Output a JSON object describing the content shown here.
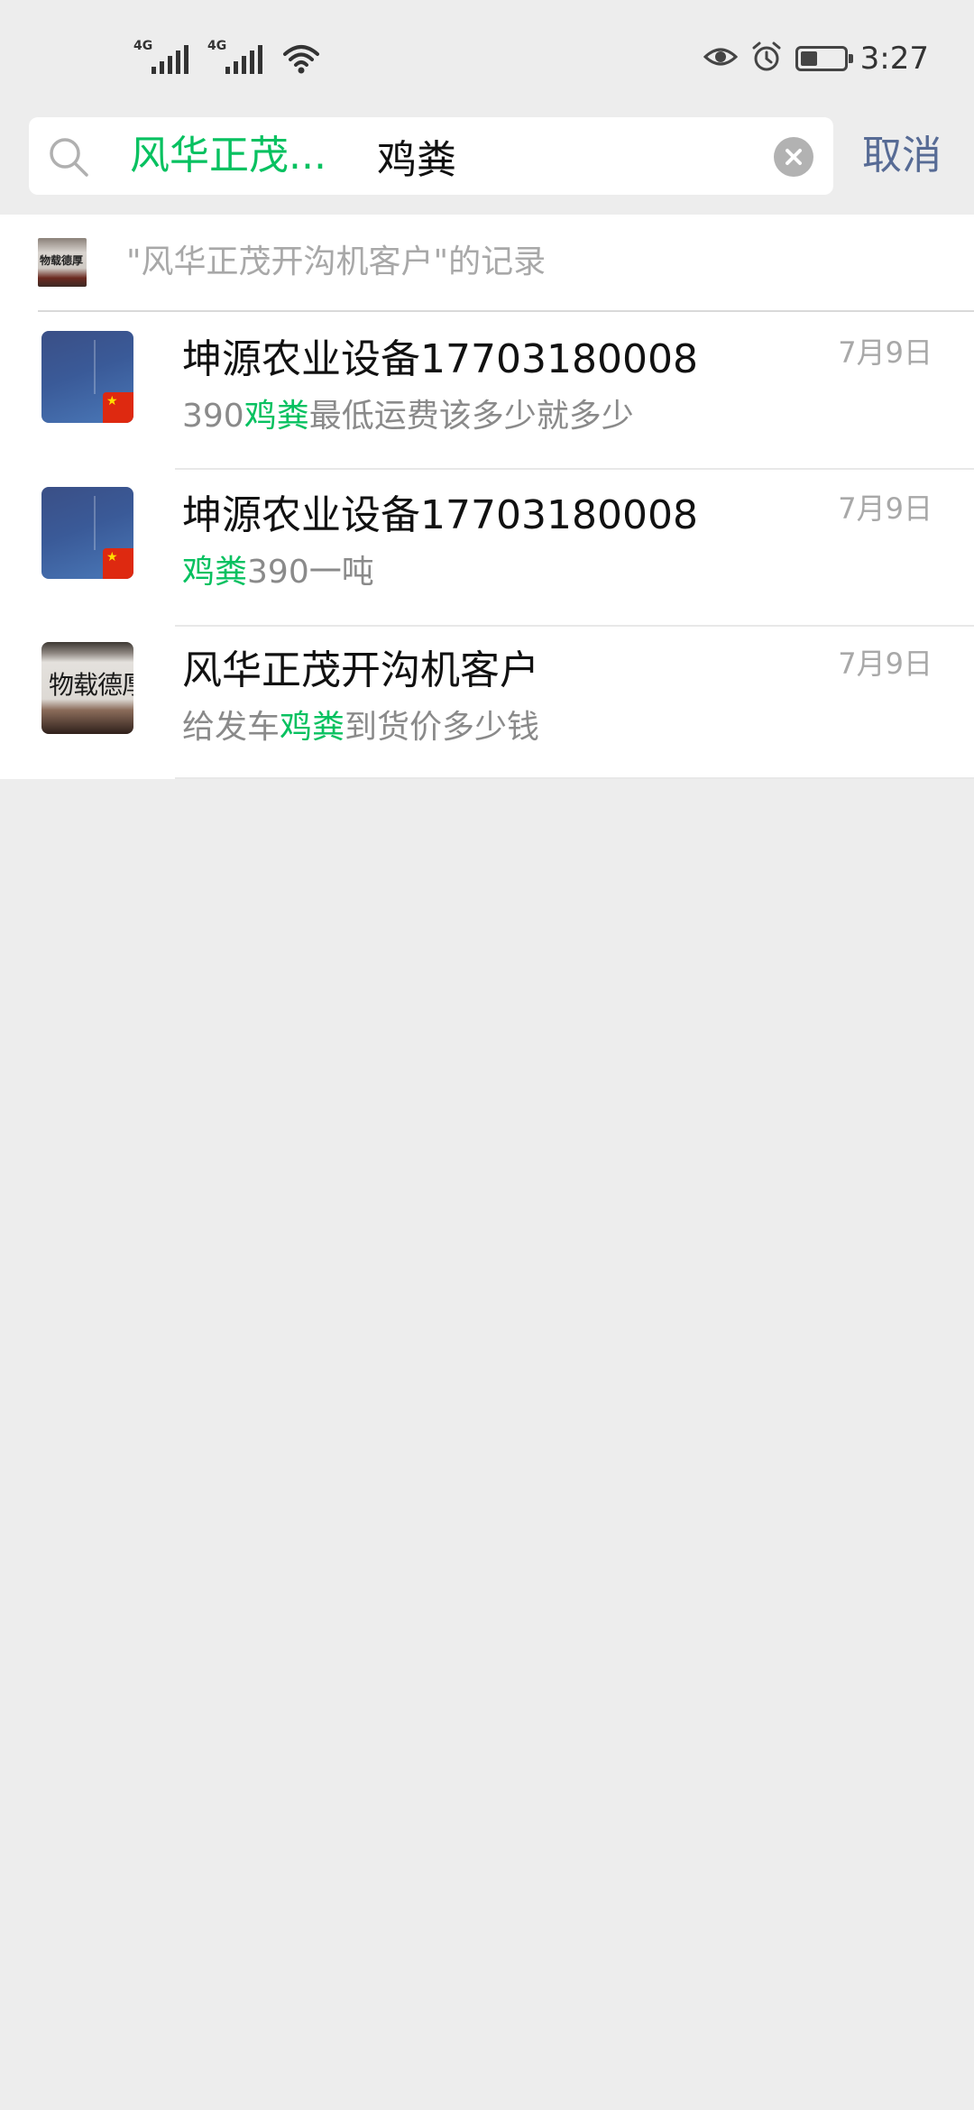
{
  "status_bar": {
    "network_1": "4G",
    "network_2": "4G",
    "time": "3:27",
    "icons": [
      "signal-icon",
      "signal-icon",
      "wifi-icon",
      "eye-icon",
      "alarm-icon",
      "battery-icon"
    ]
  },
  "search": {
    "scope_tag": "风华正茂...",
    "query": "鸡粪",
    "cancel_label": "取消"
  },
  "record_entry": {
    "label": "\"风华正茂开沟机客户\"的记录",
    "thumb_text": "物载德厚"
  },
  "results": [
    {
      "name": "坤源农业设备17703180008",
      "preview_before": "390",
      "preview_match": "鸡粪",
      "preview_after": "最低运费该多少就多少",
      "date": "7月9日"
    },
    {
      "name": "坤源农业设备17703180008",
      "preview_before": "",
      "preview_match": "鸡粪",
      "preview_after": "390一吨",
      "date": "7月9日"
    },
    {
      "name": "风华正茂开沟机客户",
      "preview_before": "给发车",
      "preview_match": "鸡粪",
      "preview_after": "到货价多少钱",
      "date": "7月9日",
      "avatar_text": "物载德厚"
    }
  ],
  "colors": {
    "highlight": "#07c160",
    "cancel": "#576b95",
    "background": "#ededed"
  }
}
